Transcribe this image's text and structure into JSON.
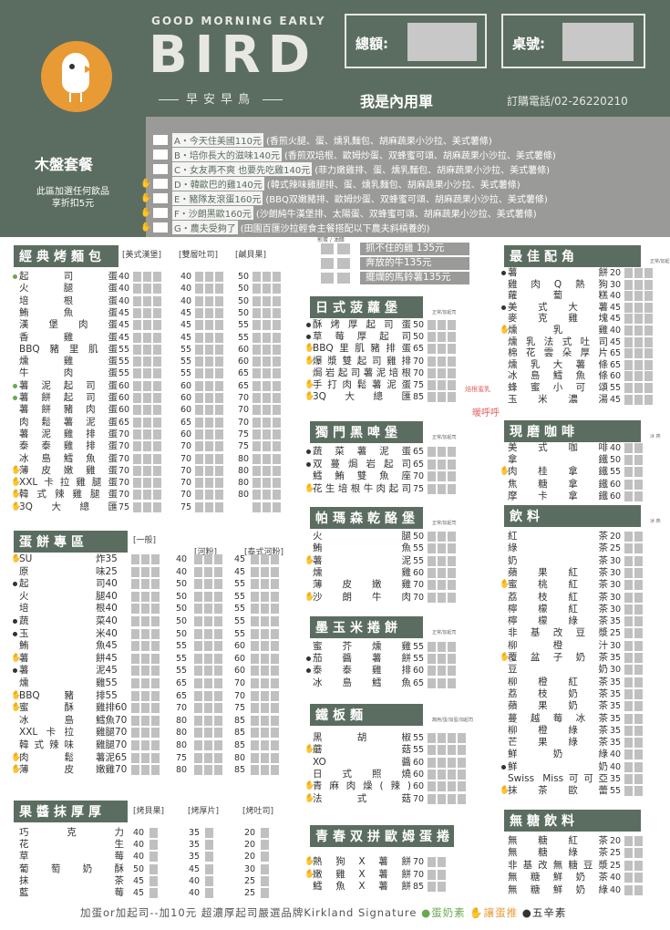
{
  "header": {
    "top": "GOOD MORNING EARLY",
    "brand": "BIRD",
    "sub": "早安早鳥",
    "total_label": "總額:",
    "table_label": "桌號:",
    "inner": "我是內用單",
    "phone": "訂購電話/02-26220210"
  },
  "set": {
    "title": "木盤套餐",
    "note": "此區加選任何飲品\n享折扣5元",
    "items": [
      {
        "code": "A・今天住美國110元",
        "desc": "(香煎火腿、蛋、燻乳麵包、胡麻蔬果小沙拉、美式薯條)",
        "mark": ""
      },
      {
        "code": "B・培你長大的滋味140元",
        "desc": "(香煎双培根、歐姆炒蛋、双蜂蜜可頌、胡麻蔬果小沙拉、美式薯條)",
        "mark": ""
      },
      {
        "code": "C・女友再不爽 也要先吃雞140元",
        "desc": "(菲力嫩雞排、蛋、燻乳麵包、胡麻蔬果小沙拉、美式薯條)",
        "mark": ""
      },
      {
        "code": "D・韓歐巴的雞140元",
        "desc": "(韓式辣味雞腿排、蛋、燻乳麵包、胡麻蔬果小沙拉、美式薯條)",
        "mark": "hand"
      },
      {
        "code": "E・豬隊友滾蛋160元",
        "desc": "(BBQ双嫩豬排、歐姆炒蛋、双蜂蜜可頌、胡麻蔬果小沙拉、美式薯條)",
        "mark": "hand"
      },
      {
        "code": "F・沙朗黑歐160元",
        "desc": "(沙朗純牛漢堡排、太陽蛋、双蜂蜜可頌、胡麻蔬果小沙拉、美式薯條)",
        "mark": "hand"
      },
      {
        "code": "G・農夫受夠了",
        "desc": "(田園百匯沙拉輕食主餐搭配以下農夫斜槓養的)",
        "mark": "hand"
      }
    ]
  },
  "farmer": {
    "hdr": "煎蛋 / 油醋",
    "items": [
      "抓不住的雞 135元",
      "奔放的牛135元",
      "擺爛的馬鈴薯135元"
    ]
  },
  "toast": {
    "title": "經典烤麵包",
    "opts": [
      "[美式漢堡]",
      "[雙層吐司]",
      "[鹹貝果]"
    ],
    "tiny": "正常/加起司",
    "rows": [
      [
        "起司蛋",
        "40",
        "40",
        "50",
        "g"
      ],
      [
        "火腿蛋",
        "40",
        "40",
        "50",
        ""
      ],
      [
        "培根蛋",
        "40",
        "40",
        "50",
        ""
      ],
      [
        "鮪魚蛋",
        "45",
        "45",
        "50",
        ""
      ],
      [
        "漢堡肉蛋",
        "45",
        "45",
        "55",
        ""
      ],
      [
        "香雞蛋",
        "45",
        "45",
        "55",
        ""
      ],
      [
        "BBQ豬里肌蛋",
        "55",
        "55",
        "60",
        ""
      ],
      [
        "燻雞蛋",
        "55",
        "55",
        "60",
        ""
      ],
      [
        "牛肉蛋",
        "55",
        "55",
        "65",
        ""
      ],
      [
        "薯泥起司蛋",
        "60",
        "60",
        "65",
        "g"
      ],
      [
        "薯餅起司蛋",
        "60",
        "60",
        "70",
        "g"
      ],
      [
        "薯餅豬肉蛋",
        "60",
        "60",
        "70",
        ""
      ],
      [
        "肉鬆薯泥蛋",
        "65",
        "65",
        "70",
        ""
      ],
      [
        "薯泥雞排蛋",
        "70",
        "60",
        "75",
        ""
      ],
      [
        "泰泰雞排蛋",
        "70",
        "70",
        "75",
        ""
      ],
      [
        "冰島鱈魚蛋",
        "70",
        "70",
        "80",
        ""
      ],
      [
        "薄皮嫩雞蛋",
        "70",
        "70",
        "80",
        "h"
      ],
      [
        "XXL卡拉雞腿蛋",
        "70",
        "70",
        "80",
        "h"
      ],
      [
        "韓式辣雞腿蛋",
        "70",
        "70",
        "80",
        "h"
      ],
      [
        "3Q大總匯",
        "75",
        "75",
        "",
        "h"
      ]
    ]
  },
  "egg": {
    "title": "蛋餅專區",
    "opts": [
      "[一般]",
      "[河粉]",
      "[泰式河粉]"
    ],
    "tiny": "正常/加起司",
    "rows": [
      [
        "SU",
        "炸35",
        "40",
        "45",
        "h"
      ],
      [
        "原",
        "味25",
        "40",
        "45",
        ""
      ],
      [
        "起",
        "司40",
        "50",
        "55",
        "b"
      ],
      [
        "火",
        "腿40",
        "50",
        "55",
        ""
      ],
      [
        "培",
        "根40",
        "50",
        "55",
        ""
      ],
      [
        "蔬",
        "菜40",
        "50",
        "55",
        "b"
      ],
      [
        "玉",
        "米40",
        "50",
        "55",
        "b"
      ],
      [
        "鮪",
        "魚45",
        "55",
        "60",
        ""
      ],
      [
        "薯",
        "餅45",
        "55",
        "60",
        "h"
      ],
      [
        "薯",
        "泥45",
        "55",
        "60",
        "b"
      ],
      [
        "燻",
        "雞55",
        "65",
        "70",
        ""
      ],
      [
        "BBQ豬",
        "排55",
        "65",
        "70",
        "h"
      ],
      [
        "蜜酥",
        "雞排60",
        "70",
        "75",
        "h"
      ],
      [
        "冰島",
        "鱈魚70",
        "80",
        "85",
        ""
      ],
      [
        "XXL卡拉",
        "雞腿70",
        "80",
        "85",
        ""
      ],
      [
        "韓式辣味",
        "雞腿70",
        "80",
        "85",
        ""
      ],
      [
        "肉鬆",
        "薯泥65",
        "75",
        "80",
        "h"
      ],
      [
        "薄皮",
        "嫩雞70",
        "80",
        "85",
        "h"
      ]
    ]
  },
  "jam": {
    "title": "果醬抹厚厚",
    "opts": [
      "[烤貝果]",
      "[烤厚片]",
      "[烤吐司]"
    ],
    "rows": [
      [
        "巧克力",
        "40",
        "35",
        "20"
      ],
      [
        "花生",
        "40",
        "35",
        "20"
      ],
      [
        "草莓",
        "40",
        "35",
        "20"
      ],
      [
        "葡萄奶酥",
        "50",
        "45",
        "30"
      ],
      [
        "抹茶",
        "45",
        "40",
        "25"
      ],
      [
        "藍莓",
        "45",
        "40",
        "25"
      ]
    ]
  },
  "jp": {
    "title": "日式菠蘿堡",
    "tiny": "正常/加起司",
    "rows": [
      [
        "酥烤厚起司蛋",
        "50",
        "b"
      ],
      [
        "草莓厚起司",
        "50",
        "b"
      ],
      [
        "BBQ里肌豬排蛋",
        "65",
        "h"
      ],
      [
        "爆漿雙起司雞排",
        "70",
        "h"
      ],
      [
        "焗岩起司薯泥培根",
        "70",
        ""
      ],
      [
        "手打肉鬆薯泥蛋",
        "75",
        "h"
      ],
      [
        "3Q大總匯",
        "85",
        "h"
      ]
    ],
    "side1": "焙根蜜乳",
    "side2": "暖呼呼"
  },
  "beer": {
    "title": "獨門黑啤堡",
    "tiny": "正常/加起司",
    "rows": [
      [
        "蔬菜薯泥蛋",
        "65",
        "b"
      ],
      [
        "双蔓焗岩起司",
        "65",
        "b"
      ],
      [
        "鱈鮪雙魚座",
        "70",
        ""
      ],
      [
        "花生培根牛肉起司",
        "75",
        "h"
      ]
    ]
  },
  "panini": {
    "title": "帕瑪森乾酪堡",
    "tiny": "正常/加起司",
    "rows": [
      [
        "火腿",
        "50",
        ""
      ],
      [
        "鮪魚",
        "55",
        ""
      ],
      [
        "薯泥",
        "55",
        "h"
      ],
      [
        "燻雞",
        "60",
        ""
      ],
      [
        "薄皮嫩雞",
        "70",
        ""
      ],
      [
        "沙朗牛肉",
        "70",
        "h"
      ]
    ]
  },
  "mex": {
    "title": "墨玉米捲餅",
    "tiny": "正常/加起司",
    "rows": [
      [
        "蜜芥燻雞",
        "55",
        ""
      ],
      [
        "茄醬薯餅",
        "55",
        "b"
      ],
      [
        "泰泰雞排",
        "60",
        "b"
      ],
      [
        "冰島鱈魚",
        "65",
        ""
      ]
    ]
  },
  "iron": {
    "title": "鐵板麵",
    "tiny": "蔬用/蛋/加蛋/加起司",
    "rows": [
      [
        "黑胡椒",
        "55",
        ""
      ],
      [
        "蘑菇",
        "55",
        "h"
      ],
      [
        "XO醬",
        "60",
        ""
      ],
      [
        "日式照燒",
        "60",
        ""
      ],
      [
        "青麻肉燥(辣)",
        "60",
        "h"
      ],
      [
        "法式菇",
        "70",
        "h"
      ]
    ]
  },
  "youth": {
    "title": "青春双拼歐姆蛋捲",
    "rows": [
      [
        "熱狗X薯餅",
        "70",
        "h"
      ],
      [
        "嫩雞X薯餅",
        "70",
        "h"
      ],
      [
        "鱈魚X薯餅",
        "85",
        ""
      ]
    ]
  },
  "best": {
    "title": "最佳配角",
    "tiny": "正常/加起司",
    "rows": [
      [
        "薯餅",
        "20",
        "b"
      ],
      [
        "雞肉Q熱狗",
        "30",
        ""
      ],
      [
        "蘿蔔糕",
        "40",
        ""
      ],
      [
        "美式大薯",
        "45",
        "b"
      ],
      [
        "麥克雞塊",
        "45",
        ""
      ],
      [
        "燻乳雞",
        "40",
        "h"
      ],
      [
        "燻乳法式吐司",
        "45",
        ""
      ],
      [
        "棉花雲朵厚片",
        "65",
        ""
      ],
      [
        "燻乳大薯條",
        "65",
        ""
      ],
      [
        "冰島鱈魚條",
        "60",
        ""
      ],
      [
        "蜂蜜小可頌",
        "55",
        ""
      ],
      [
        "玉米濃湯",
        "45",
        ""
      ]
    ]
  },
  "coffee": {
    "title": "現磨咖啡",
    "tiny": "冰 熱",
    "rows": [
      [
        "美式咖啡",
        "40",
        ""
      ],
      [
        "拿鐵",
        "50",
        ""
      ],
      [
        "肉桂拿鐵",
        "55",
        "h"
      ],
      [
        "焦糖拿鐵",
        "60",
        ""
      ],
      [
        "摩卡拿鐵",
        "60",
        ""
      ]
    ]
  },
  "drink": {
    "title": "飲料",
    "tiny": "冰 熱",
    "rows": [
      [
        "紅茶",
        "20",
        ""
      ],
      [
        "綠茶",
        "25",
        ""
      ],
      [
        "奶茶",
        "30",
        ""
      ],
      [
        "蘋果紅茶",
        "30",
        ""
      ],
      [
        "蜜桃紅茶",
        "30",
        "h"
      ],
      [
        "荔枝紅茶",
        "30",
        ""
      ],
      [
        "檸檬紅茶",
        "30",
        ""
      ],
      [
        "檸檬綠茶",
        "35",
        ""
      ],
      [
        "非基改豆漿",
        "25",
        ""
      ],
      [
        "柳橙汁",
        "30",
        ""
      ],
      [
        "覆盆子奶茶",
        "35",
        "h"
      ],
      [
        "豆奶",
        "30",
        ""
      ],
      [
        "柳橙紅茶",
        "35",
        ""
      ],
      [
        "荔枝奶茶",
        "35",
        ""
      ],
      [
        "蘋果奶茶",
        "35",
        ""
      ],
      [
        "蔓越莓冰茶",
        "35",
        ""
      ],
      [
        "柳橙綠茶",
        "35",
        ""
      ],
      [
        "芒果綠茶",
        "35",
        ""
      ],
      [
        "鮮奶綠",
        "40",
        ""
      ],
      [
        "鮮奶",
        "40",
        "b"
      ],
      [
        "Swiss Miss可可亞",
        "35",
        ""
      ],
      [
        "抹茶歐蕾",
        "55",
        "h"
      ]
    ]
  },
  "sugar": {
    "title": "無糖飲料",
    "rows": [
      [
        "無糖紅茶",
        "20",
        ""
      ],
      [
        "無糖綠茶",
        "25",
        ""
      ],
      [
        "非基改無糖豆漿",
        "25",
        ""
      ],
      [
        "無糖鮮奶茶",
        "40",
        ""
      ],
      [
        "無糖鮮奶綠",
        "40",
        ""
      ]
    ]
  },
  "footer": {
    "text": "加蛋or加起司--加10元  超濃厚起司嚴選品牌Kirkland Signature",
    "legend": [
      "蛋奶素",
      "讓蛋推",
      "五辛素"
    ]
  }
}
